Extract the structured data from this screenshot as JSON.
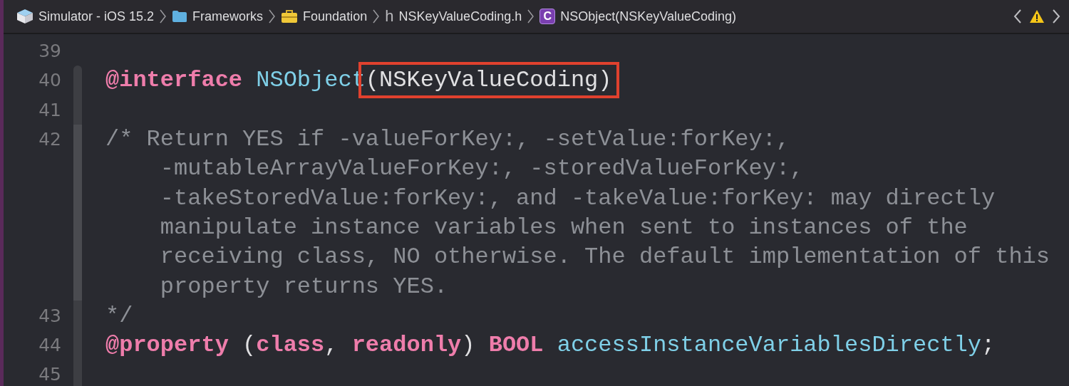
{
  "breadcrumbs": [
    {
      "kind": "package",
      "label": "Simulator - iOS 15.2"
    },
    {
      "kind": "folder",
      "label": "Frameworks"
    },
    {
      "kind": "toolbox",
      "label": "Foundation"
    },
    {
      "kind": "header",
      "label": "h",
      "file": "NSKeyValueCoding.h"
    },
    {
      "kind": "class",
      "label": "C",
      "file": "NSObject(NSKeyValueCoding)"
    }
  ],
  "lines": [
    {
      "number": "39"
    },
    {
      "number": "40",
      "tokens": [
        {
          "kind": "keyword",
          "text": "@interface"
        },
        {
          "kind": "type",
          "text": " NSObject"
        },
        {
          "kind": "plain",
          "text": "(NSKeyValueCoding)",
          "highlighted": true
        }
      ]
    },
    {
      "number": "41"
    },
    {
      "number": "42",
      "tokens": [
        {
          "kind": "comment",
          "text": "/* Return YES if -valueForKey:, -setValue:forKey:,"
        }
      ]
    },
    {
      "tokens": [
        {
          "kind": "comment",
          "text": "    -mutableArrayValueForKey:, -storedValueForKey:,"
        }
      ]
    },
    {
      "tokens": [
        {
          "kind": "comment",
          "text": "    -takeStoredValue:forKey:, and -takeValue:forKey: may directly"
        }
      ]
    },
    {
      "tokens": [
        {
          "kind": "comment",
          "text": "    manipulate instance variables when sent to instances of the"
        }
      ]
    },
    {
      "tokens": [
        {
          "kind": "comment",
          "text": "    receiving class, NO otherwise. The default implementation of this"
        }
      ]
    },
    {
      "tokens": [
        {
          "kind": "comment",
          "text": "    property returns YES."
        }
      ]
    },
    {
      "number": "43",
      "tokens": [
        {
          "kind": "comment",
          "text": "*/"
        }
      ]
    },
    {
      "number": "44",
      "tokens": [
        {
          "kind": "keyword",
          "text": "@property"
        },
        {
          "kind": "plain",
          "text": " ("
        },
        {
          "kind": "keyword",
          "text": "class"
        },
        {
          "kind": "plain",
          "text": ", "
        },
        {
          "kind": "keyword",
          "text": "readonly"
        },
        {
          "kind": "plain",
          "text": ") "
        },
        {
          "kind": "keyword",
          "text": "BOOL"
        },
        {
          "kind": "type",
          "text": " accessInstanceVariablesDirectly"
        },
        {
          "kind": "plain",
          "text": ";"
        }
      ]
    },
    {
      "number": "45"
    }
  ]
}
